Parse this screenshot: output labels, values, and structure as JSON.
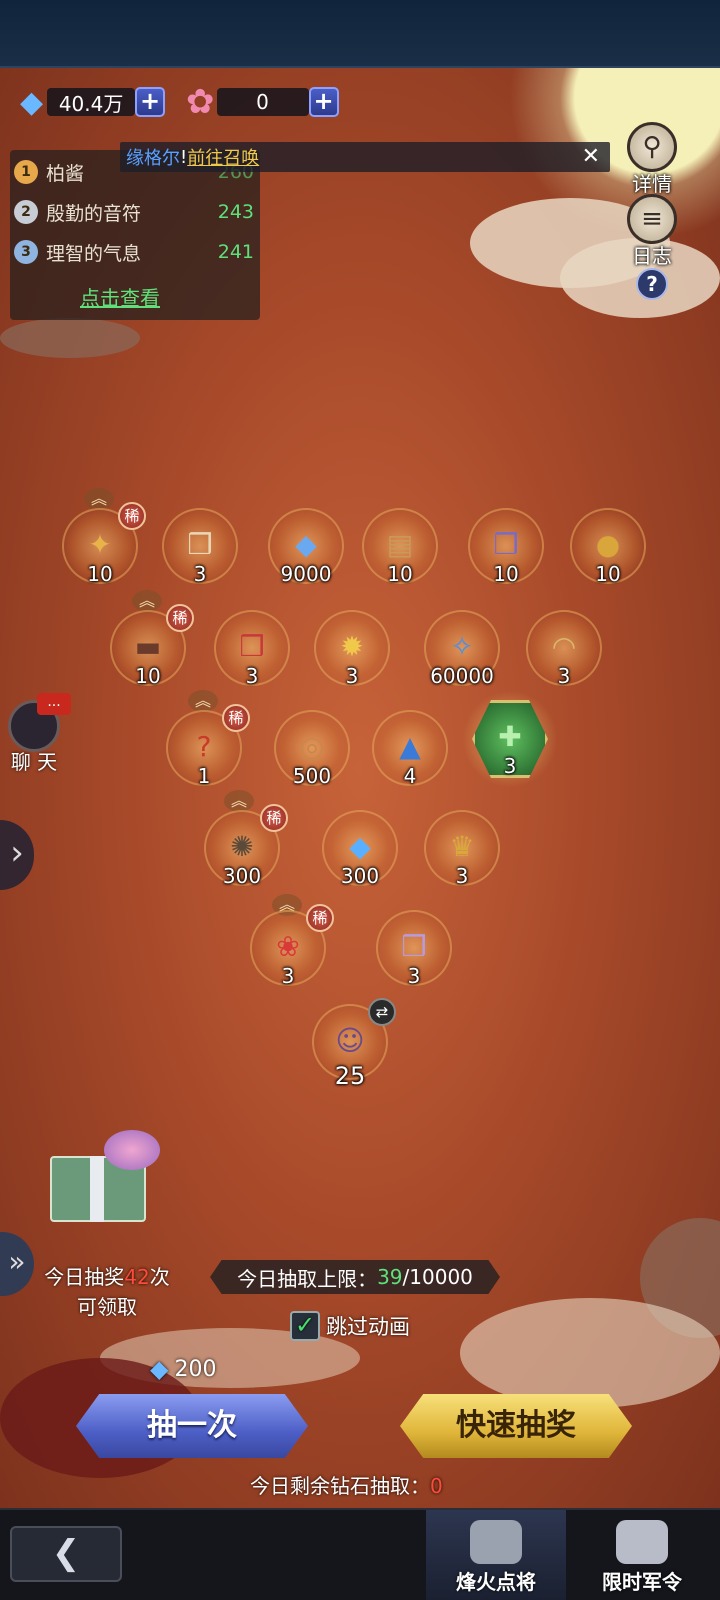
{
  "currency": {
    "diamond_amount": "40.4万",
    "flower_amount": "0"
  },
  "ranking": {
    "items": [
      {
        "rank": "1",
        "name": "柏酱",
        "score": "260"
      },
      {
        "rank": "2",
        "name": "殷勤的音符",
        "score": "243"
      },
      {
        "rank": "3",
        "name": "理智的气息",
        "score": "241"
      }
    ],
    "view_link": "点击查看"
  },
  "marquee": {
    "name": "缘格尔",
    "excl": "!",
    "link": "前往召唤"
  },
  "side": {
    "details_label": "详情",
    "log_label": "日志",
    "help_label": "?"
  },
  "chat": {
    "label": "聊 天",
    "bubble": "..."
  },
  "rare_label": "稀",
  "rewards": [
    {
      "qty": "10",
      "icon": "golden-shrine-icon",
      "rare": true
    },
    {
      "qty": "3",
      "icon": "gift-box-icon",
      "rare": false
    },
    {
      "qty": "9000",
      "icon": "blue-crystal-icon",
      "rare": false
    },
    {
      "qty": "10",
      "icon": "scroll-bundle-icon",
      "rare": false
    },
    {
      "qty": "10",
      "icon": "purple-gift-icon",
      "rare": false
    },
    {
      "qty": "10",
      "icon": "gold-coins-icon",
      "rare": false
    },
    {
      "qty": "10",
      "icon": "cannon-icon",
      "rare": true
    },
    {
      "qty": "3",
      "icon": "red-gift-icon",
      "rare": false
    },
    {
      "qty": "3",
      "icon": "golden-lamp-icon",
      "rare": false
    },
    {
      "qty": "60000",
      "icon": "blue-shards-icon",
      "rare": false
    },
    {
      "qty": "3",
      "icon": "golden-mask-icon",
      "rare": false
    },
    {
      "qty": "1",
      "icon": "mystery-box-icon",
      "rare": true
    },
    {
      "qty": "500",
      "icon": "swirl-token-icon",
      "rare": false
    },
    {
      "qty": "4",
      "icon": "blue-gem-icon",
      "rare": false
    },
    {
      "qty": "3",
      "icon": "green-emblem-icon",
      "rare": false
    },
    {
      "qty": "300",
      "icon": "sun-medallion-icon",
      "rare": true
    },
    {
      "qty": "300",
      "icon": "diamond-icon",
      "rare": false
    },
    {
      "qty": "3",
      "icon": "treasure-pile-icon",
      "rare": false
    },
    {
      "qty": "3",
      "icon": "red-rose-icon",
      "rare": true
    },
    {
      "qty": "3",
      "icon": "lilac-gift-icon",
      "rare": false
    },
    {
      "qty": "25",
      "icon": "hero-shard-icon",
      "rare": false
    }
  ],
  "claim": {
    "prefix": "今日抽奖",
    "count": "42",
    "suffix": "次",
    "line2": "可领取"
  },
  "limit": {
    "label": "今日抽取上限：",
    "current": "39",
    "total": "/10000"
  },
  "skip": {
    "label": "跳过动画",
    "checked": true
  },
  "cost": {
    "amount": "200"
  },
  "buttons": {
    "draw_once": "抽一次",
    "fast_draw": "快速抽奖"
  },
  "remain": {
    "label": "今日剩余钻石抽取：",
    "value": "0"
  },
  "nav": {
    "tab1": "烽火点将",
    "tab2": "限时军令"
  },
  "colors": {
    "accent_green": "#5fe07a",
    "accent_red": "#ff4a3a",
    "draw_button": "#4d5fc6",
    "fast_button": "#e0b63a"
  }
}
